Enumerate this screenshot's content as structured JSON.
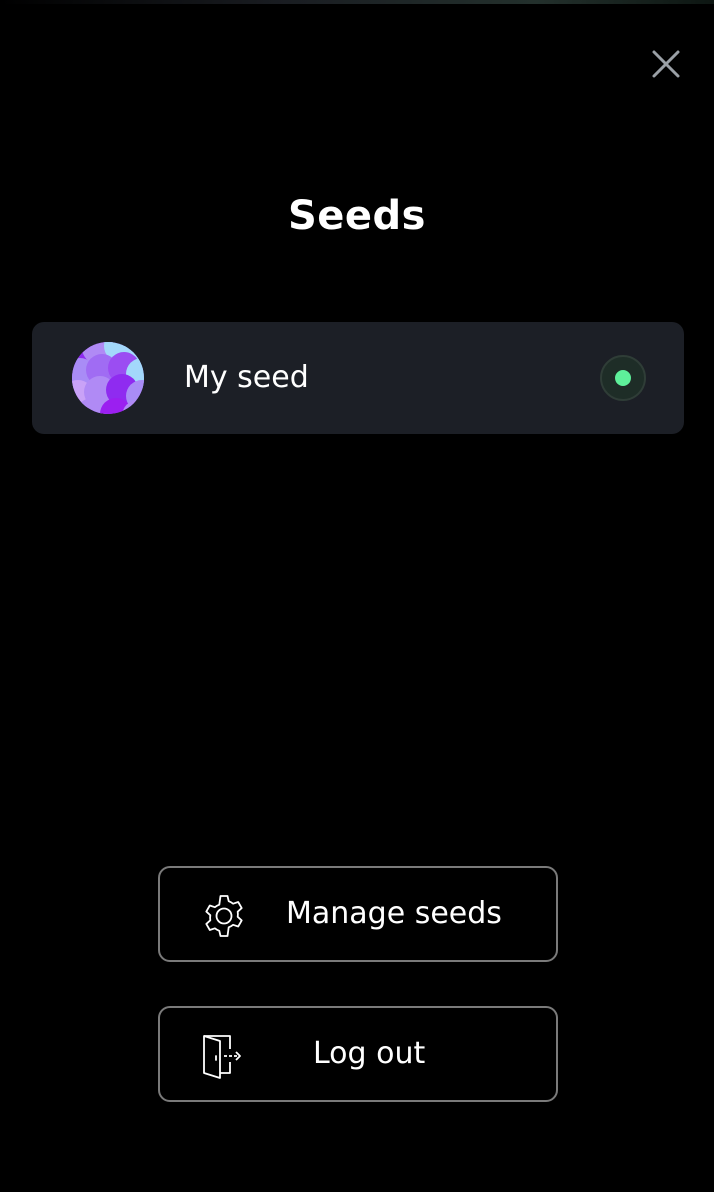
{
  "header": {
    "title": "Seeds",
    "close_icon": "close-icon"
  },
  "seeds": [
    {
      "name": "My seed",
      "avatar_icon": "seed-avatar",
      "selected": true
    }
  ],
  "actions": {
    "manage_label": "Manage seeds",
    "manage_icon": "gear-icon",
    "logout_label": "Log out",
    "logout_icon": "door-exit-icon"
  },
  "colors": {
    "background": "#000000",
    "card": "#1c1f26",
    "accent": "#5ef09a",
    "button_border": "#7a7a7a",
    "avatar_purple": "#8f2bf0",
    "avatar_lavender": "#b08af5",
    "avatar_light_blue": "#a3d8fb"
  }
}
